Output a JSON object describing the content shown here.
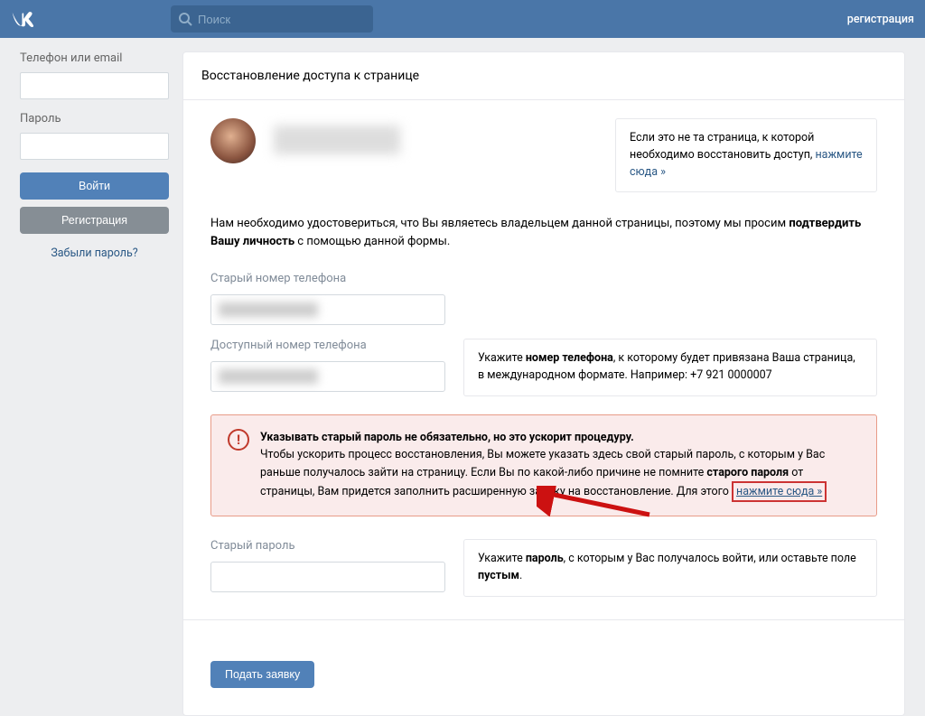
{
  "header": {
    "search_placeholder": "Поиск",
    "register_link": "регистрация"
  },
  "sidebar": {
    "phone_label": "Телефон или email",
    "password_label": "Пароль",
    "login_button": "Войти",
    "register_button": "Регистрация",
    "forgot_link": "Забыли пароль?"
  },
  "content": {
    "title": "Восстановление доступа к странице",
    "wrong_page": {
      "text_before": "Если это не та страница, к которой необходимо восстановить доступ, ",
      "link": "нажмите сюда »"
    },
    "instruction": {
      "text_before": "Нам необходимо удостовериться, что Вы являетесь владельцем данной страницы, поэтому мы просим ",
      "bold": "подтвердить Вашу личность",
      "text_after": " с помощью данной формы."
    },
    "old_phone_label": "Старый номер телефона",
    "avail_phone_label": "Доступный номер телефона",
    "phone_help": {
      "t1": "Укажите ",
      "b1": "номер телефона",
      "t2": ", к которому будет привязана Ваша страница, в международном формате. Например: +7 921 0000007"
    },
    "warning": {
      "bold1": "Указывать старый пароль не обязательно, но это ускорит процедуру.",
      "t1": "Чтобы ускорить процесс восстановления, Вы можете указать здесь свой старый пароль, с которым у Вас раньше получалось зайти на страницу. Если Вы по какой-либо причине не помните ",
      "b2": "старого пароля",
      "t2": " от страницы, Вам придется заполнить расширенную заявку на восстановление. Для этого ",
      "link": "нажмите сюда »"
    },
    "old_password_label": "Старый пароль",
    "password_help": {
      "t1": "Укажите ",
      "b1": "пароль",
      "t2": ", с которым у Вас получалось войти, или оставьте поле ",
      "b2": "пустым",
      "t3": "."
    },
    "submit_button": "Подать заявку"
  }
}
